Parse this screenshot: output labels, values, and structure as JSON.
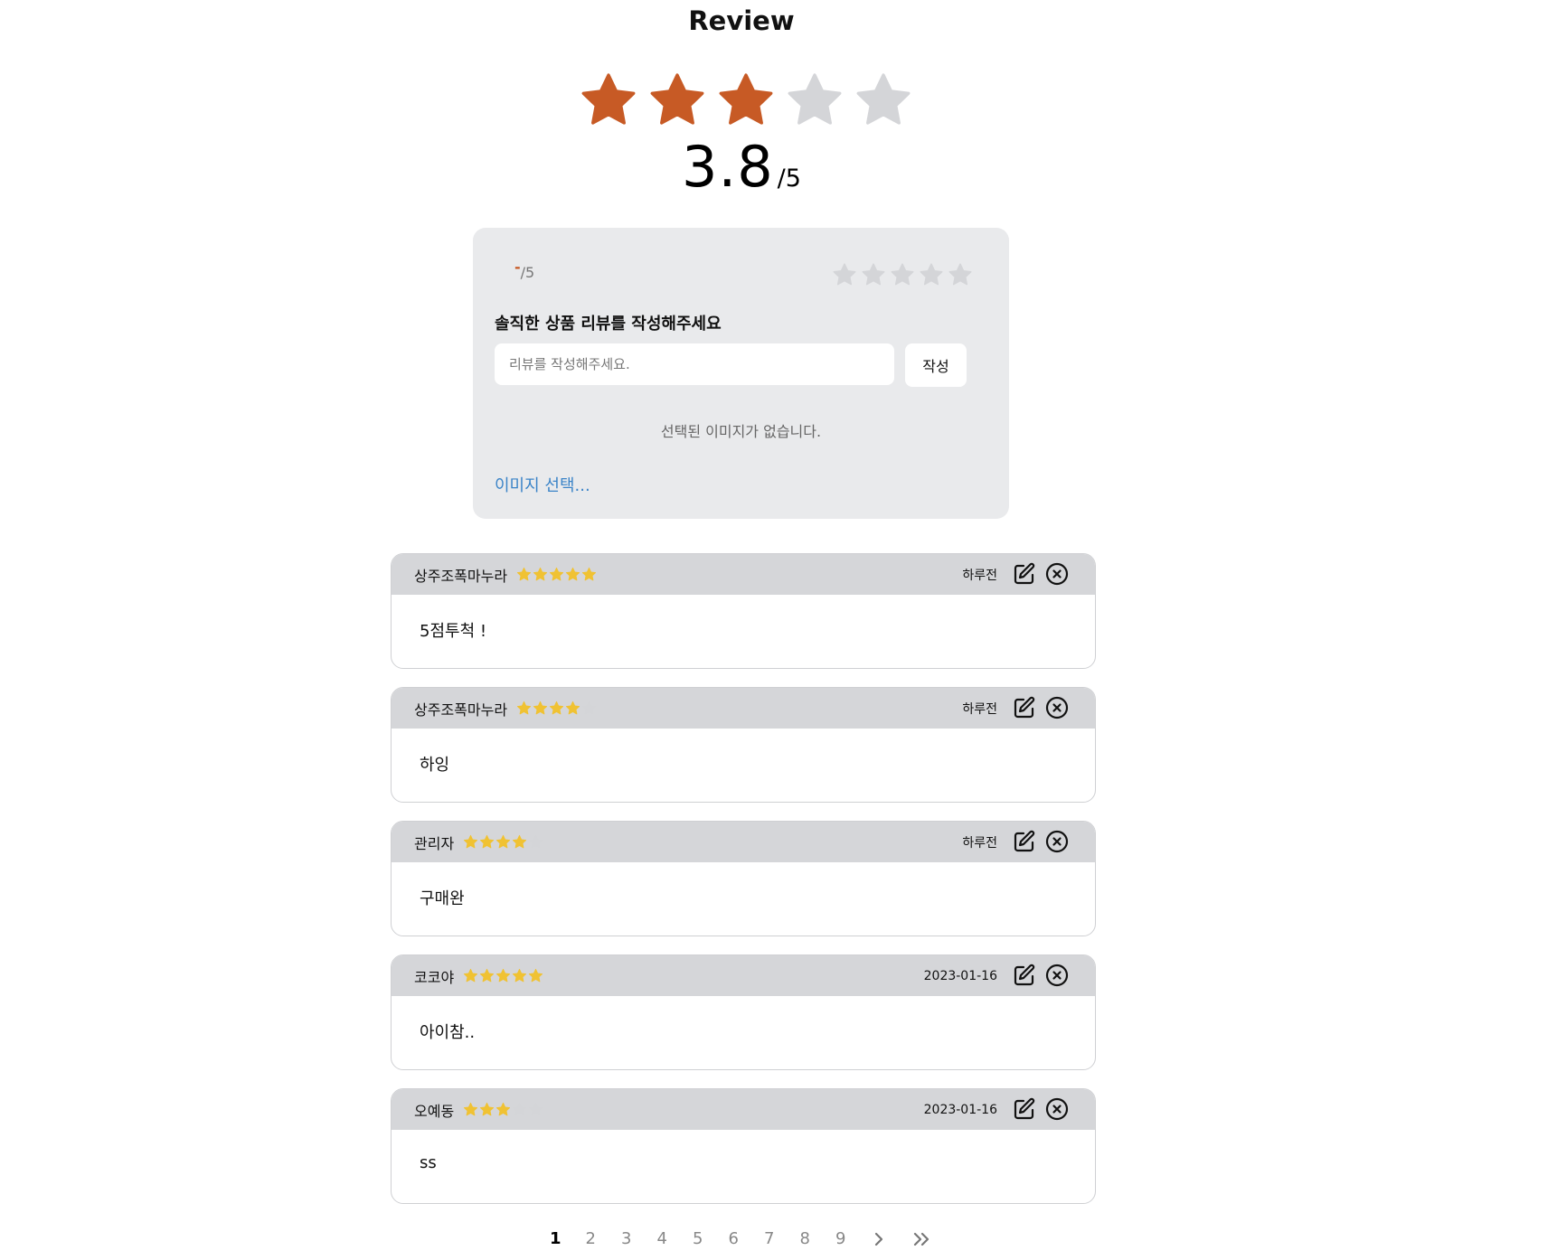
{
  "header": {
    "title": "Review"
  },
  "summary": {
    "average": "3.8",
    "out_of": "/5",
    "filled_stars": 3,
    "total_stars": 5,
    "star_color": "#c75a25",
    "empty_star_color": "#d4d5d8"
  },
  "write_panel": {
    "score_dash": "-",
    "score_out_of": "/5",
    "heading": "솔직한 상품 리뷰를 작성해주세요",
    "input_placeholder": "리뷰를 작성해주세요.",
    "input_value": "",
    "submit_label": "작성",
    "no_image_text": "선택된 이미지가 없습니다.",
    "select_image_label": "이미지 선택..."
  },
  "reviews": [
    {
      "author": "상주조폭마누라",
      "rating": 5,
      "date": "하루전",
      "text": "5점투척 !"
    },
    {
      "author": "상주조폭마누라",
      "rating": 4,
      "date": "하루전",
      "text": "하잉"
    },
    {
      "author": "관리자",
      "rating": 4,
      "date": "하루전",
      "text": "구매완"
    },
    {
      "author": "코코야",
      "rating": 5,
      "date": "2023-01-16",
      "text": "아이참.."
    },
    {
      "author": "오예동",
      "rating": 3,
      "date": "2023-01-16",
      "text": "ss"
    }
  ],
  "review_star_color": "#f0c233",
  "pagination": {
    "pages": [
      "1",
      "2",
      "3",
      "4",
      "5",
      "6",
      "7",
      "8",
      "9"
    ],
    "current": "1",
    "next_icon": "chevron-right-icon",
    "last_icon": "double-chevron-right-icon"
  },
  "icons": {
    "edit": "edit-icon",
    "delete": "close-circle-icon"
  }
}
